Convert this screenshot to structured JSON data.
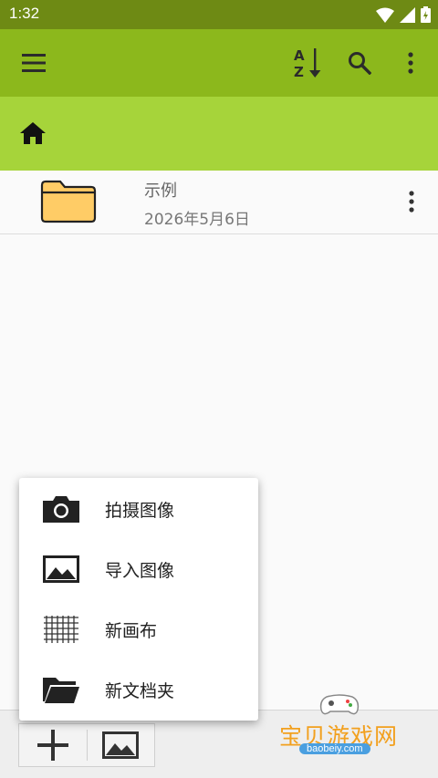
{
  "status_bar": {
    "time": "1:32",
    "icons": [
      "wifi-icon",
      "signal-icon",
      "battery-icon"
    ]
  },
  "toolbar": {
    "icons": [
      "menu-icon",
      "sort-az-icon",
      "search-icon",
      "more-vertical-icon"
    ]
  },
  "breadcrumb": {
    "icon": "home-icon"
  },
  "files": [
    {
      "name": "示例",
      "date": "2026年5月6日",
      "icon": "folder-icon"
    }
  ],
  "popup_menu": {
    "items": [
      {
        "label": "拍摄图像",
        "icon": "camera-icon"
      },
      {
        "label": "导入图像",
        "icon": "image-icon"
      },
      {
        "label": "新画布",
        "icon": "grid-icon"
      },
      {
        "label": "新文档夹",
        "icon": "folder-open-icon"
      }
    ]
  },
  "bottom_bar": {
    "icons": [
      "add-icon",
      "image-icon"
    ]
  },
  "watermark": {
    "text": "宝贝游戏网",
    "url": "baobeiy.com"
  },
  "colors": {
    "status_bar": "#6e8a14",
    "toolbar": "#8cb81c",
    "breadcrumb": "#a6d43a",
    "folder": "#ffcc66"
  }
}
